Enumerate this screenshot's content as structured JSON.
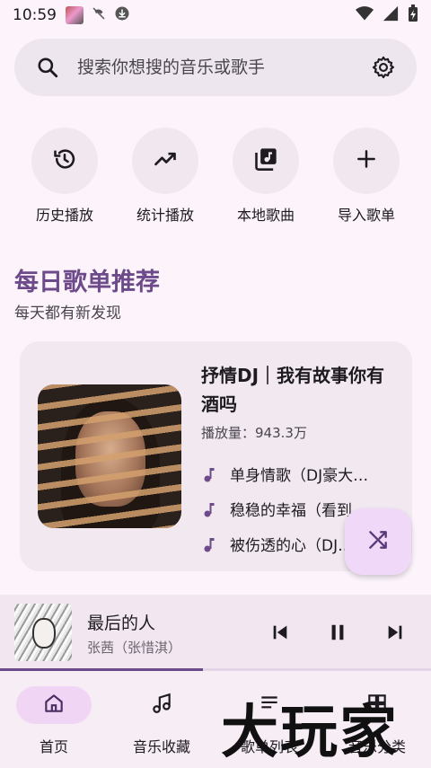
{
  "status_bar": {
    "time": "10:59"
  },
  "search": {
    "placeholder": "搜索你想搜的音乐或歌手"
  },
  "quick_actions": [
    {
      "icon": "history-icon",
      "label": "历史播放"
    },
    {
      "icon": "trending-icon",
      "label": "统计播放"
    },
    {
      "icon": "library-music-icon",
      "label": "本地歌曲"
    },
    {
      "icon": "plus-icon",
      "label": "导入歌单"
    }
  ],
  "daily": {
    "title": "每日歌单推荐",
    "subtitle": "每天都有新发现"
  },
  "playlist": {
    "title": "抒情DJ｜我有故事你有酒吗",
    "plays": "播放量：943.3万",
    "tracks": [
      "单身情歌（DJ豪大…",
      "稳稳的幸福（看到…",
      "被伤透的心（DJ…"
    ]
  },
  "now_playing": {
    "title": "最后的人",
    "artist": "张茜（张惜淇）",
    "progress": 0.47
  },
  "bottom_nav": [
    {
      "label": "首页",
      "icon": "home-icon",
      "active": true
    },
    {
      "label": "音乐收藏",
      "icon": "music-note-icon",
      "active": false
    },
    {
      "label": "歌单列表",
      "icon": "list-icon",
      "active": false
    },
    {
      "label": "音乐分类",
      "icon": "grid-icon",
      "active": false
    }
  ],
  "watermark": "大玩家",
  "colors": {
    "accent": "#6d4a8a",
    "background": "#fcf3fb",
    "fab": "#f0d9f8"
  }
}
